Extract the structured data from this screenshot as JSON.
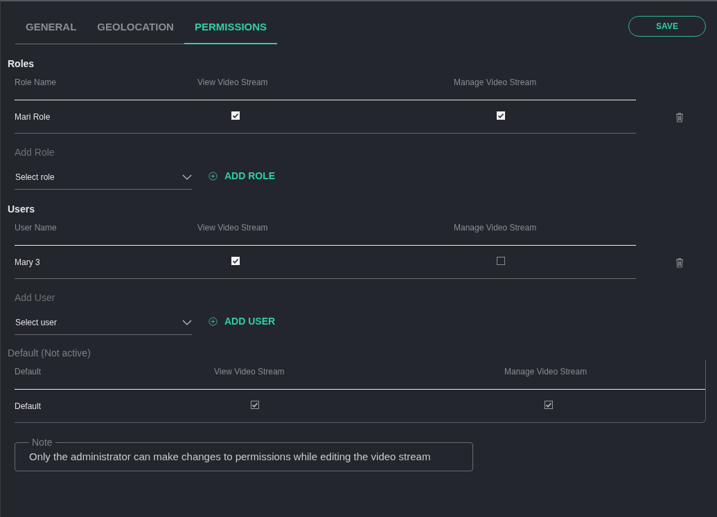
{
  "tabs": [
    {
      "label": "GENERAL",
      "selected": false
    },
    {
      "label": "GEOLOCATION",
      "selected": false
    },
    {
      "label": "PERMISSIONS",
      "selected": true
    }
  ],
  "save_button": "SAVE",
  "roles": {
    "title": "Roles",
    "columns": [
      "Role Name",
      "View Video Stream",
      "Manage Video Stream"
    ],
    "rows": [
      {
        "name": "Mari Role",
        "view": true,
        "manage": true
      }
    ],
    "add_label": "Add Role",
    "select_placeholder": "Select role",
    "add_button": "ADD ROLE"
  },
  "users": {
    "title": "Users",
    "columns": [
      "User Name",
      "View Video Stream",
      "Manage Video Stream"
    ],
    "rows": [
      {
        "name": "Mary 3",
        "view": true,
        "manage": false
      }
    ],
    "add_label": "Add User",
    "select_placeholder": "Select user",
    "add_button": "ADD USER"
  },
  "default": {
    "title": "Default (Not active)",
    "active": false,
    "columns": [
      "Default",
      "View Video Stream",
      "Manage Video Stream"
    ],
    "rows": [
      {
        "name": "Default",
        "view": true,
        "manage": true
      }
    ]
  },
  "note": {
    "legend": "Note",
    "text": "Only the administrator can make changes to permissions while editing the video stream"
  }
}
